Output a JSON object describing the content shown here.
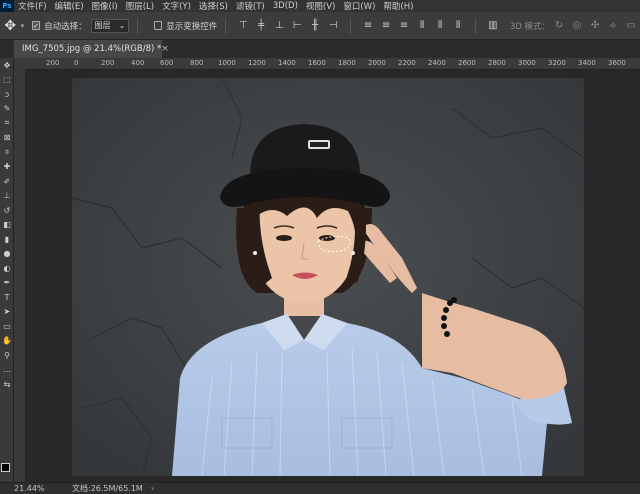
{
  "app": {
    "logo": "Ps"
  },
  "menu": [
    "文件(F)",
    "编辑(E)",
    "图像(I)",
    "图层(L)",
    "文字(Y)",
    "选择(S)",
    "滤镜(T)",
    "3D(D)",
    "视图(V)",
    "窗口(W)",
    "帮助(H)"
  ],
  "options": {
    "auto_select_label": "自动选择：",
    "auto_select_checked": true,
    "target_value": "图层",
    "show_transform_label": "显示变换控件",
    "show_transform_checked": false,
    "mode_3d_label": "3D 模式："
  },
  "document": {
    "tab_title": "IMG_7505.jpg @ 21.4%(RGB/8) *",
    "close_glyph": "×"
  },
  "ruler": {
    "ticks": [
      "200",
      "0",
      "200",
      "400",
      "600",
      "800",
      "1000",
      "1200",
      "1400",
      "1600",
      "1800",
      "2000",
      "2200",
      "2400",
      "2600",
      "2800",
      "3000",
      "3200",
      "3400",
      "3600"
    ]
  },
  "status": {
    "zoom": "21.44%",
    "doc_info": "文档:26.5M/65.1M",
    "arrow": "›"
  }
}
